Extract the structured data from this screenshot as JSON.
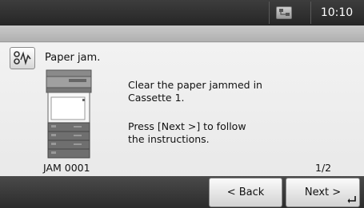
{
  "status_bar": {
    "clock": "10:10",
    "status_icon": "network-status-icon"
  },
  "message": {
    "icon": "paper-jam-icon",
    "title": "Paper jam.",
    "instruction_1_line1": "Clear the paper jammed in",
    "instruction_1_line2": "Cassette 1.",
    "instruction_2_line1": "Press [Next >] to follow",
    "instruction_2_line2": "the instructions.",
    "jam_code": "JAM 0001",
    "page": "1/2"
  },
  "buttons": {
    "back_label": "< Back",
    "next_label": "Next >",
    "next_icon": "enter-return-icon"
  },
  "colors": {
    "status_bar": "#2e2e2e",
    "content_bg": "#efefef",
    "button_bg": "#e4e4e4"
  }
}
